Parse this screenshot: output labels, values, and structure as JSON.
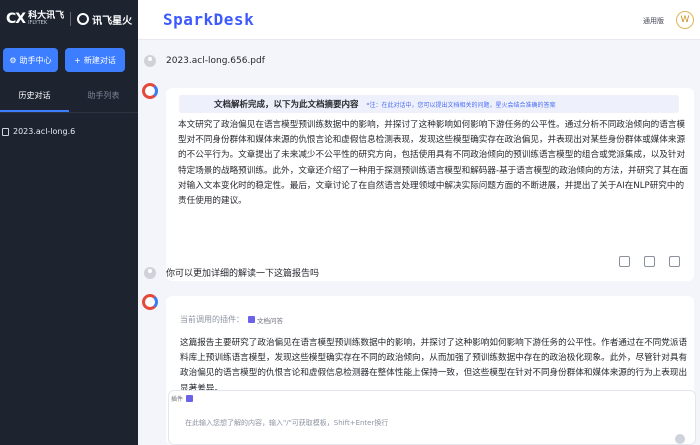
{
  "brand": {
    "logo1_mark": "CX",
    "logo1_text": "科大讯飞",
    "logo1_sub": "IFLYTEK",
    "logo2_text": "讯飞星火"
  },
  "sidebar": {
    "help_button": "助手中心",
    "new_chat_button": "新建对话",
    "tabs": [
      "历史对话",
      "助手列表"
    ],
    "history": [
      {
        "label": "2023.acl-long.6"
      }
    ]
  },
  "header": {
    "title": "SparkDesk",
    "version": "通用版",
    "avatar_initial": "W"
  },
  "conversation": {
    "user_msg_1": "2023.acl-long.656.pdf",
    "summary_title": "文档解析完成，以下为此文档摘要内容",
    "summary_note": "*注：在此对话中，您可以提出文档相关的问题，星火会结合准确的答案",
    "summary_body": "本文研究了政治偏见在语言模型预训练数据中的影响，并探讨了这种影响如何影响下游任务的公平性。通过分析不同政治倾向的语言模型对不同身份群体和媒体来源的仇恨言论和虚假信息检测表现，发现这些模型确实存在政治偏见，并表现出对某些身份群体或媒体来源的不公平行为。文章提出了未来减少不公平性的研究方向，包括使用具有不同政治倾向的预训练语言模型的组合或党派集成，以及针对特定场景的战略预训练。此外，文章还介绍了一种用于探测预训练语言模型和解码器-基于语言模型的政治倾向的方法，并研究了其在面对输入文本变化时的稳定性。最后，文章讨论了在自然语言处理领域中解决实际问题方面的不断进展，并提出了关于AI在NLP研究中的责任使用的建议。",
    "user_msg_2": "你可以更加详细的解读一下这篇报告吗",
    "plugin_label": "当前调用的插件：",
    "plugin_name": "文档问答",
    "answer_body": "这篇报告主要研究了政治偏见在语言模型预训练数据中的影响，并探讨了这种影响如何影响下游任务的公平性。作者通过在不同党派语料库上预训练语言模型，发现这些模型确实存在不同的政治倾向，从而加强了预训练数据中存在的政治极化现象。此外，尽管针对具有政治偏见的语言模型的仇恨言论和虚假信息检测器在整体性能上保持一致，但这些模型在针对不同身份群体和媒体来源的行为上表现出显著差异。"
  },
  "input": {
    "plugin_tag": "插件",
    "placeholder": "在此输入您想了解的内容，输入\"/\"可获取模板，Shift+Enter换行"
  },
  "colors": {
    "accent": "#3d7dff",
    "sidebar_bg": "#1d2430",
    "brand_blue": "#3d5afe"
  }
}
